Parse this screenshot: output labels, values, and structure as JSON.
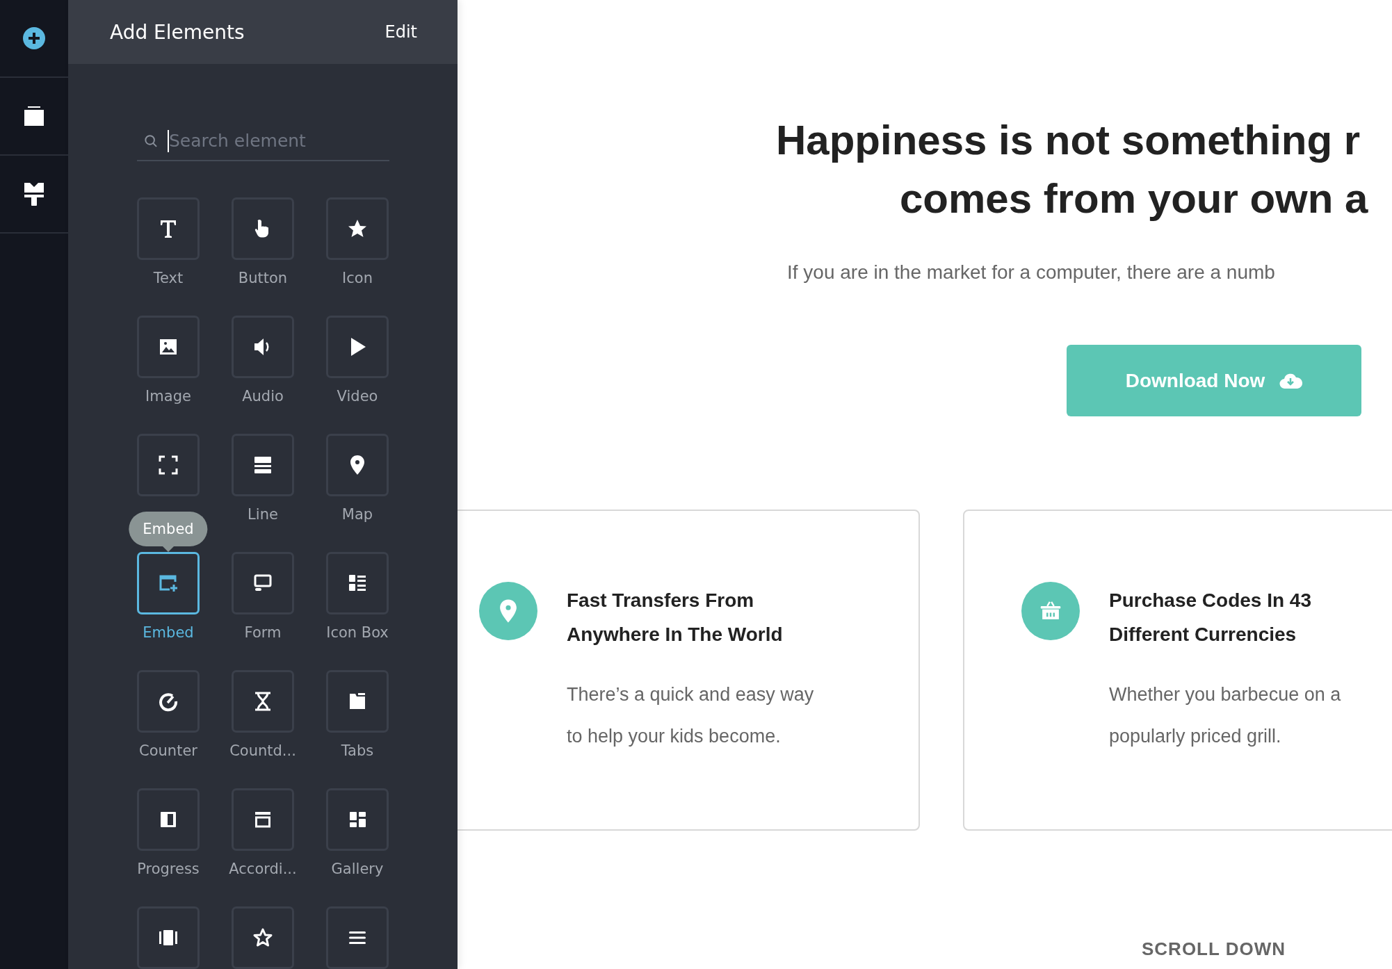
{
  "rail": [
    {
      "kind": "add",
      "selected": true
    },
    {
      "kind": "layers",
      "selected": false
    },
    {
      "kind": "brush",
      "selected": false
    }
  ],
  "panel": {
    "title": "Add Elements",
    "edit": "Edit",
    "search": {
      "placeholder": "Search element"
    },
    "elements": [
      {
        "label": "Text",
        "kind": "text",
        "selected": false
      },
      {
        "label": "Button",
        "kind": "hand",
        "selected": false
      },
      {
        "label": "Icon",
        "kind": "star",
        "selected": false
      },
      {
        "label": "Image",
        "kind": "image",
        "selected": false
      },
      {
        "label": "Audio",
        "kind": "audio",
        "selected": false
      },
      {
        "label": "Video",
        "kind": "video",
        "selected": false
      },
      {
        "kind": "corners",
        "selected": false
      },
      {
        "label": "Line",
        "kind": "line",
        "selected": false
      },
      {
        "label": "Map",
        "kind": "pin",
        "selected": false
      },
      {
        "label": "Embed",
        "kind": "embed",
        "selected": true,
        "tooltip": "Embed"
      },
      {
        "label": "Form",
        "kind": "form",
        "selected": false
      },
      {
        "label": "Icon Box",
        "kind": "iconbox",
        "selected": false
      },
      {
        "label": "Counter",
        "kind": "gauge",
        "selected": false
      },
      {
        "label": "Countd...",
        "kind": "hourglass",
        "selected": false
      },
      {
        "label": "Tabs",
        "kind": "folder",
        "selected": false
      },
      {
        "label": "Progress",
        "kind": "progress",
        "selected": false
      },
      {
        "label": "Accordi...",
        "kind": "accordion",
        "selected": false
      },
      {
        "label": "Gallery",
        "kind": "gallery",
        "selected": false
      },
      {
        "kind": "columns",
        "selected": false
      },
      {
        "kind": "starline",
        "selected": false
      },
      {
        "kind": "menu",
        "selected": false
      }
    ]
  },
  "hero": {
    "heading_lines": [
      "Happiness is not something r",
      "comes from your own a"
    ],
    "subtitle": "If you are in the market for a computer, there are a numb",
    "button": "Download Now"
  },
  "cards": [
    {
      "kind": "pin",
      "title_lines": [
        "Fast Transfers From",
        "Anywhere In The World"
      ],
      "body_lines": [
        "There’s a quick and easy way",
        "to help your kids become."
      ]
    },
    {
      "kind": "basket",
      "title_lines": [
        "Purchase Codes In 43",
        "Different Currencies"
      ],
      "body_lines": [
        "Whether you barbecue on a",
        "popularly priced grill."
      ]
    }
  ],
  "scroll_hint": "SCROLL DOWN"
}
